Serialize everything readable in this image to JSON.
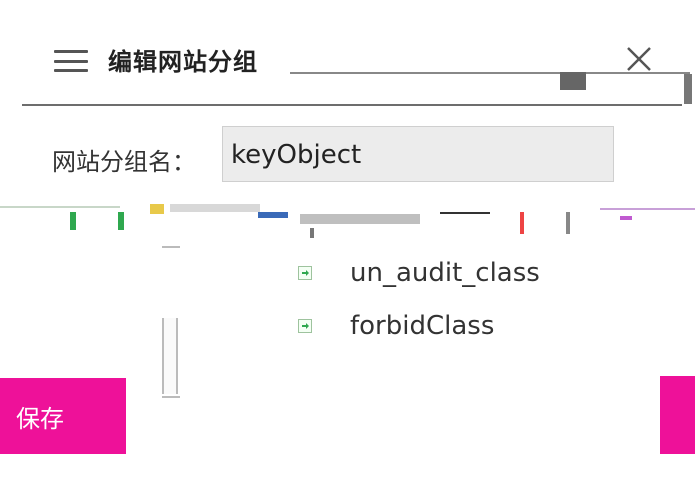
{
  "dialog": {
    "title": "编辑网站分组",
    "close_icon": "close-icon",
    "menu_icon": "menu-icon"
  },
  "form": {
    "group_name_label": "网站分组名：",
    "group_name_value": "keyObject"
  },
  "tree": {
    "items": [
      {
        "label": "un_audit_class",
        "icon": "class-item-icon"
      },
      {
        "label": "forbidClass",
        "icon": "class-item-icon"
      }
    ]
  },
  "actions": {
    "save_label": "保存"
  },
  "colors": {
    "accent": "#ee1199",
    "input_bg": "#ececec",
    "tree_icon_green": "#2fa84f"
  }
}
